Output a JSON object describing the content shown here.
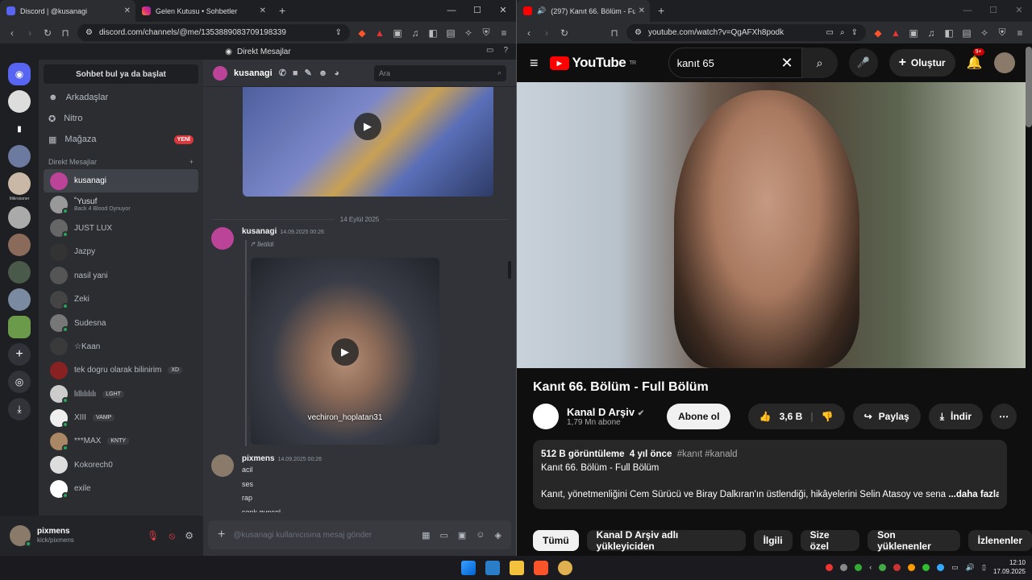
{
  "left_browser": {
    "tabs": [
      {
        "title": "Discord | @kusanagi",
        "active": true
      },
      {
        "title": "Gelen Kutusu • Sohbetler",
        "active": false
      }
    ],
    "url": "discord.com/channels/@me/1353889083709198339"
  },
  "discord": {
    "top_title": "Direkt Mesajlar",
    "search_dm": "Sohbet bul ya da başlat",
    "nav": [
      {
        "label": "Arkadaşlar",
        "icon": "friends-icon"
      },
      {
        "label": "Nitro",
        "icon": "nitro-icon"
      },
      {
        "label": "Mağaza",
        "icon": "shop-icon",
        "badge": "YENİ"
      }
    ],
    "dm_header": "Direkt Mesajlar",
    "dms": [
      {
        "name": "kusanagi",
        "selected": true
      },
      {
        "name": "˚Yusuf",
        "sub": "Back 4 Blood Oynuyor"
      },
      {
        "name": "JUST LUX"
      },
      {
        "name": "Jazpy"
      },
      {
        "name": "nasil yani"
      },
      {
        "name": "Zeki"
      },
      {
        "name": "Sudesna"
      },
      {
        "name": "☆Kaan"
      },
      {
        "name": "tek dogru olarak bilinirim",
        "tag": "XD"
      },
      {
        "name": "lıllılılılı",
        "tag": "LGHT"
      },
      {
        "name": "XIII",
        "tag": "VAMP"
      },
      {
        "name": "***MAX",
        "tag": "KNTY"
      },
      {
        "name": "Kokorech0"
      },
      {
        "name": "exile"
      }
    ],
    "guild_label": "Mikrosoner",
    "user": {
      "name": "pixmens",
      "sub": "kick/pixmens"
    },
    "channel": {
      "name": "kusanagi",
      "search_placeholder": "Ara",
      "date_sep": "14 Eylül 2025",
      "msg1": {
        "author": "kusanagi",
        "time": "14.09.2025 00:26",
        "forwarded": "İletildi",
        "caption": "vechiron_hoplatan31"
      },
      "msg2": {
        "author": "pixmens",
        "time": "14.09.2025 00:26",
        "lines": [
          "acil",
          "ses",
          "rap",
          "sonk guncel"
        ]
      },
      "composer_placeholder": "@kusanagi kullanıcısına mesaj gönder"
    }
  },
  "right_browser": {
    "tabs": [
      {
        "title": "(297) Kanıt 66. Bölüm - Full B",
        "active": true
      }
    ],
    "url": "youtube.com/watch?v=QgAFXh8podk"
  },
  "youtube": {
    "logo": "YouTube",
    "region": "TR",
    "search_value": "kanıt 65",
    "create": "Oluştur",
    "notif": "9+",
    "title": "Kanıt 66. Bölüm - Full Bölüm",
    "channel": "Kanal D Arşiv",
    "subs": "1,79 Mn abone",
    "subscribe": "Abone ol",
    "likes": "3,6 B",
    "share": "Paylaş",
    "download": "İndir",
    "desc": {
      "views": "512 B görüntüleme",
      "age": "4 yıl önce",
      "tags": "#kanıt #kanald",
      "line1": "Kanıt 66. Bölüm - Full Bölüm",
      "line2": "Kanıt, yönetmenliğini Cem Sürücü ve Biray Dalkıran'ın üstlendiği, hikâyelerini Selin Atasoy ve sena",
      "more": "...daha fazla"
    },
    "chips": [
      "Tümü",
      "Kanal D Arşiv adlı yükleyiciden",
      "İlgili",
      "Size özel",
      "Son yüklenenler",
      "İzlenenler"
    ]
  },
  "taskbar": {
    "time": "12:10",
    "date": "17.09.2025"
  }
}
